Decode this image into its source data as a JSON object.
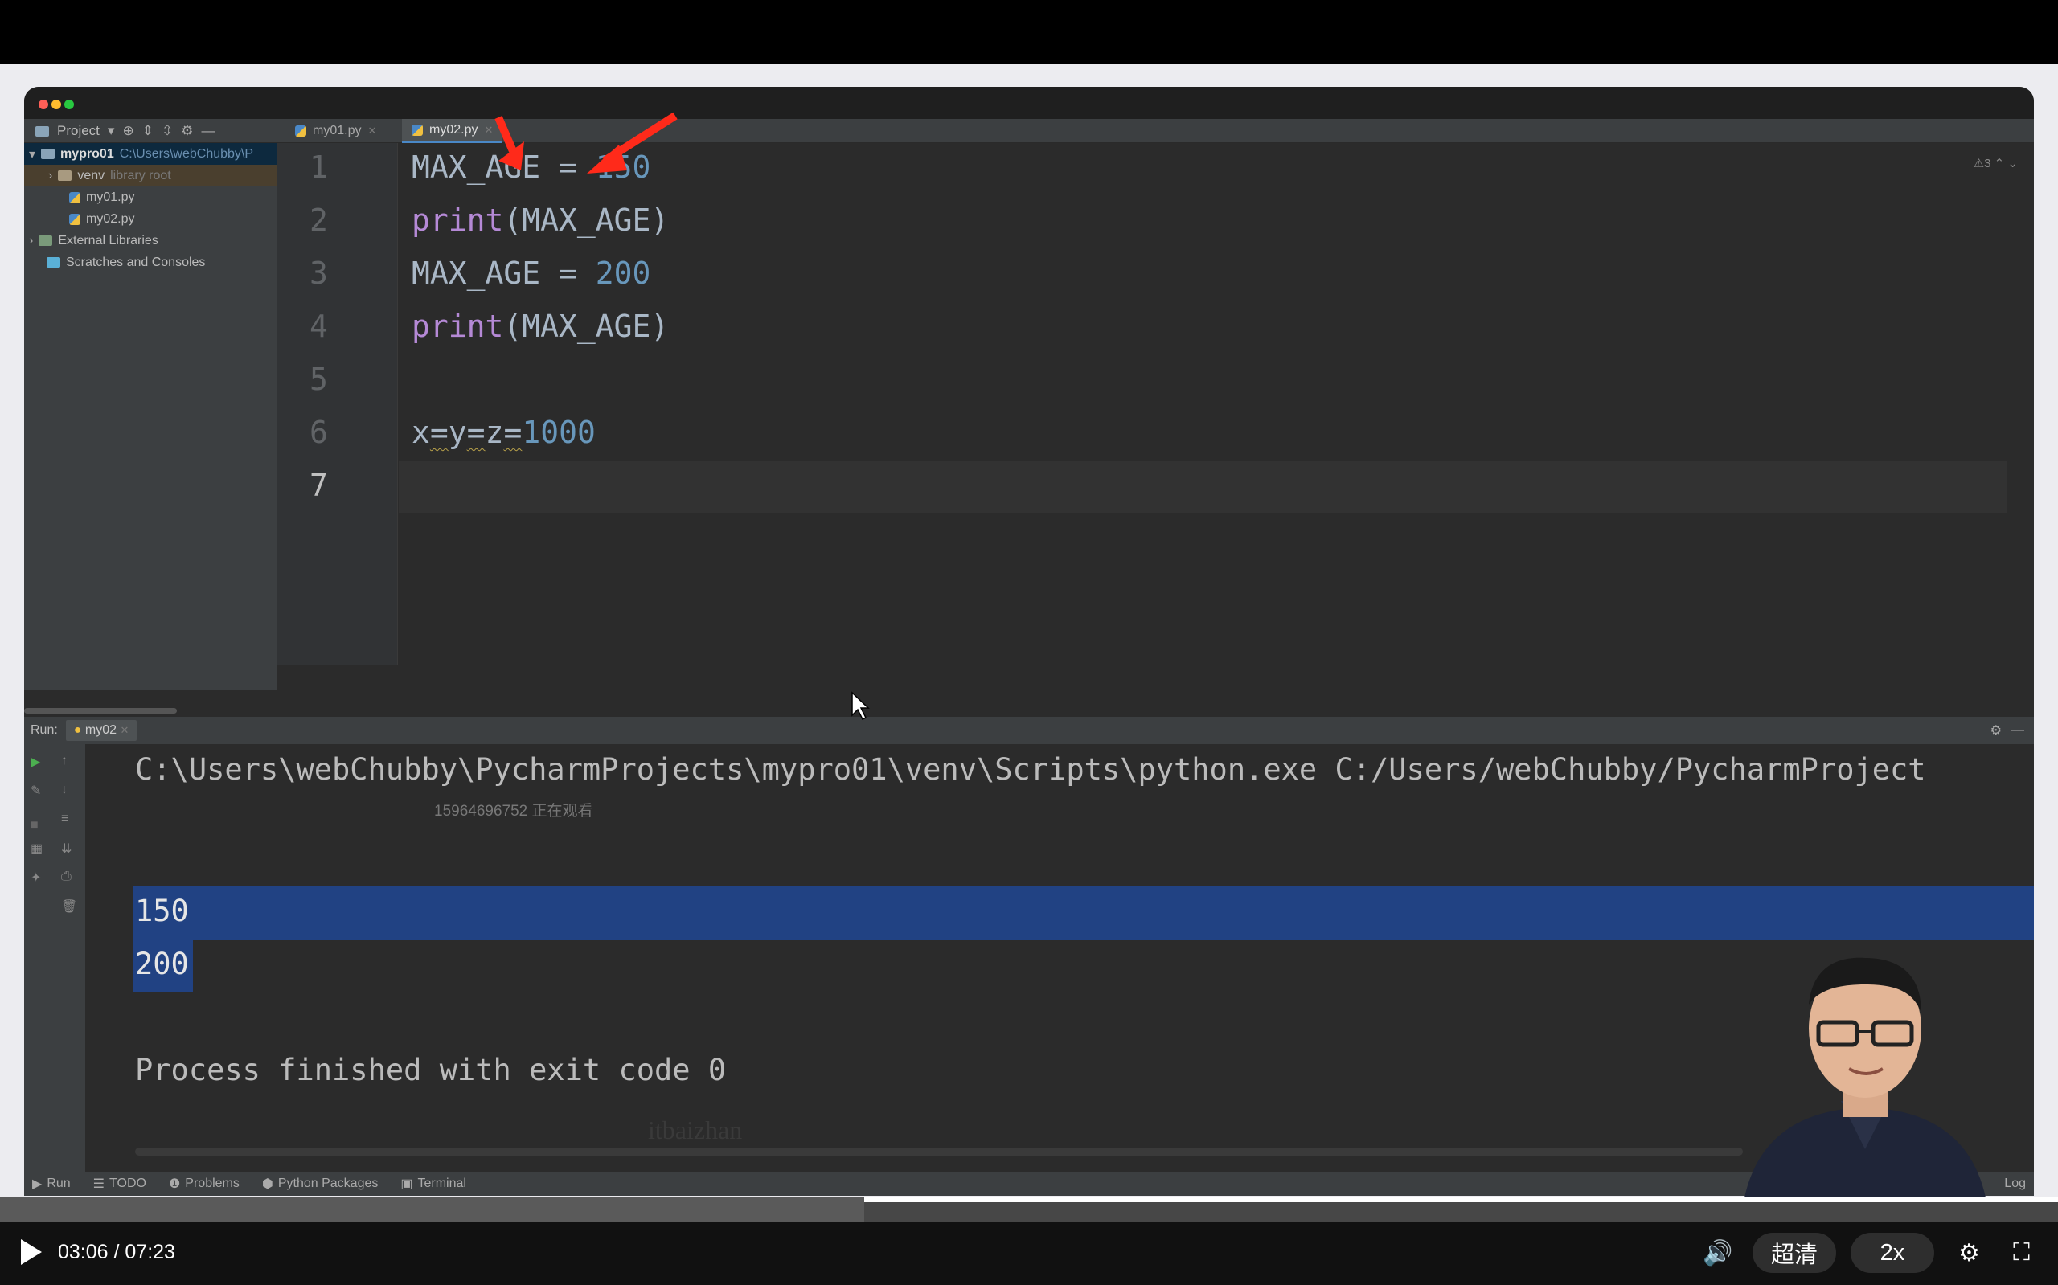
{
  "ide": {
    "project_label": "Project",
    "tabs": [
      {
        "label": "my01.py"
      },
      {
        "label": "my02.py"
      }
    ],
    "tree": {
      "root_name": "mypro01",
      "root_path": "C:\\Users\\webChubby\\P",
      "venv": "venv",
      "venv_note": "library root",
      "file1": "my01.py",
      "file2": "my02.py",
      "external": "External Libraries",
      "scratches": "Scratches and Consoles"
    },
    "line_numbers": [
      "1",
      "2",
      "3",
      "4",
      "5",
      "6",
      "7"
    ],
    "code": {
      "l1_var": "MAX_AGE = ",
      "l1_num": "150",
      "l2_fn": "print",
      "l2_rest": "(MAX_AGE)",
      "l3_var": "MAX_AGE = ",
      "l3_num": "200",
      "l4_fn": "print",
      "l4_rest": "(MAX_AGE)",
      "l6_x": "x",
      "l6_eq1": "=",
      "l6_y": "y",
      "l6_eq2": "=",
      "l6_z": "z",
      "l6_eq3": "=",
      "l6_num": "1000"
    },
    "warning_count": "3",
    "run": {
      "label": "Run:",
      "tab": "my02",
      "command": "C:\\Users\\webChubby\\PycharmProjects\\mypro01\\venv\\Scripts\\python.exe C:/Users/webChubby/PycharmProject",
      "out1": "150",
      "out2": "200",
      "finish": "Process finished with exit code 0",
      "watermark_top": "15964696752 正在观看",
      "watermark_bottom": "itbaizhan"
    },
    "statusbar": {
      "run": "Run",
      "todo": "TODO",
      "problems": "Problems",
      "packages": "Python Packages",
      "terminal": "Terminal",
      "log": "Log"
    }
  },
  "player": {
    "time": "03:06 / 07:23",
    "quality": "超清",
    "speed": "2x",
    "progress_fraction": 0.42
  },
  "colors": {
    "accent_red": "#ff2a1a",
    "selection": "#214283",
    "number": "#6897bb",
    "builtin": "#b589d6"
  }
}
